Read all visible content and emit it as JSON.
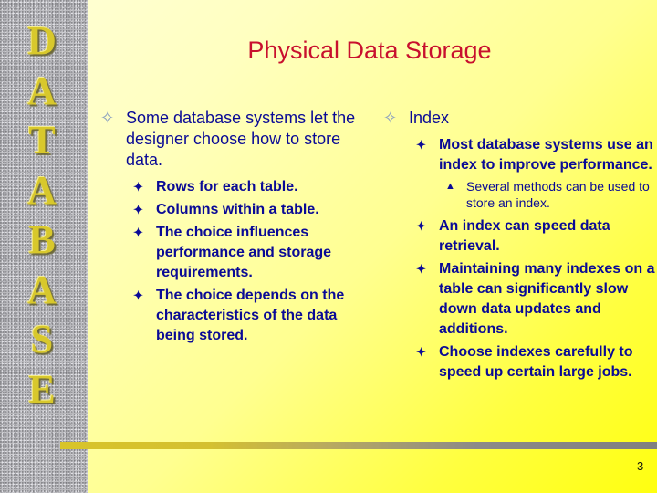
{
  "sidebar": {
    "letters": [
      "D",
      "A",
      "T",
      "A",
      "B",
      "A",
      "S",
      "E"
    ]
  },
  "title": "Physical Data Storage",
  "left_column": {
    "bullet_icon": "hollow-four-point-star",
    "text": "Some database systems let the designer choose how to store data.",
    "sub_bullet_icon": "solid-four-point-star",
    "sub_items": [
      "Rows for each table.",
      "Columns within a table.",
      "The choice influences performance and storage requirements.",
      "The choice depends on the characteristics of the data being stored."
    ]
  },
  "right_column": {
    "bullet_icon": "hollow-four-point-star",
    "text": "Index",
    "sub_items": [
      {
        "text": "Most database systems use an index to improve performance.",
        "sub_items": [
          "Several methods can be used to store an index."
        ]
      },
      {
        "text": "An index can speed data retrieval."
      },
      {
        "text": "Maintaining many indexes on a table can significantly slow down data updates and additions."
      },
      {
        "text": "Choose indexes carefully to speed up certain large jobs."
      }
    ]
  },
  "page_number": "3",
  "colors": {
    "title": "#c8102e",
    "body_text": "#0a0a96",
    "sidebar_letters": "#d8c82c"
  }
}
